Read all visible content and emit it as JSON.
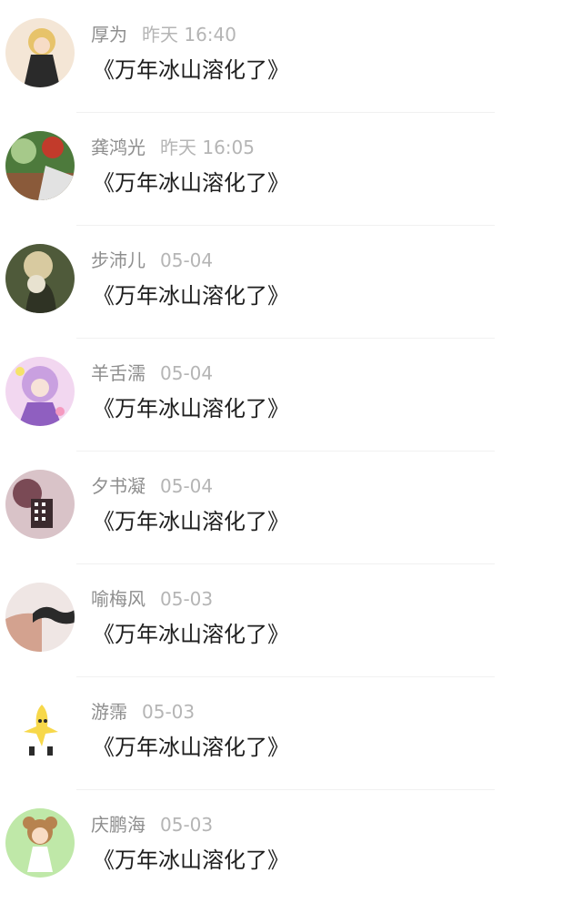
{
  "comments": [
    {
      "author": "厚为",
      "time": "昨天 16:40",
      "text": "《万年冰山溶化了》",
      "avatar_icon": "anime-character-avatar",
      "avatar_colors": [
        "#f4e6d6",
        "#2a2a2a",
        "#e7c36a"
      ]
    },
    {
      "author": "龚鸿光",
      "time": "昨天 16:05",
      "text": "《万年冰山溶化了》",
      "avatar_icon": "plants-photo-avatar",
      "avatar_colors": [
        "#4d7a3c",
        "#8a5a3a",
        "#a6c98a"
      ]
    },
    {
      "author": "步沛儿",
      "time": "05-04",
      "text": "《万年冰山溶化了》",
      "avatar_icon": "cat-photo-avatar",
      "avatar_colors": [
        "#4f5a3a",
        "#d8caa0",
        "#2f3324"
      ]
    },
    {
      "author": "羊舌濡",
      "time": "05-04",
      "text": "《万年冰山溶化了》",
      "avatar_icon": "anime-girl-avatar",
      "avatar_colors": [
        "#c9a0e0",
        "#f2d7f0",
        "#8f5fc0"
      ]
    },
    {
      "author": "夕书凝",
      "time": "05-04",
      "text": "《万年冰山溶化了》",
      "avatar_icon": "flower-photo-avatar",
      "avatar_colors": [
        "#7a4a55",
        "#d9c3c8",
        "#3b2a2e"
      ]
    },
    {
      "author": "喻梅风",
      "time": "05-03",
      "text": "《万年冰山溶化了》",
      "avatar_icon": "mustache-finger-avatar",
      "avatar_colors": [
        "#efe6e4",
        "#d3a28f",
        "#2a2a2a"
      ]
    },
    {
      "author": "游霈",
      "time": "05-03",
      "text": "《万年冰山溶化了》",
      "avatar_icon": "banana-cartoon-avatar",
      "avatar_colors": [
        "#ffffff",
        "#f7d84a",
        "#2b2b2b"
      ]
    },
    {
      "author": "庆鹏海",
      "time": "05-03",
      "text": "《万年冰山溶化了》",
      "avatar_icon": "bear-girl-cartoon-avatar",
      "avatar_colors": [
        "#bfe8a8",
        "#b7834f",
        "#ffffff"
      ]
    }
  ]
}
